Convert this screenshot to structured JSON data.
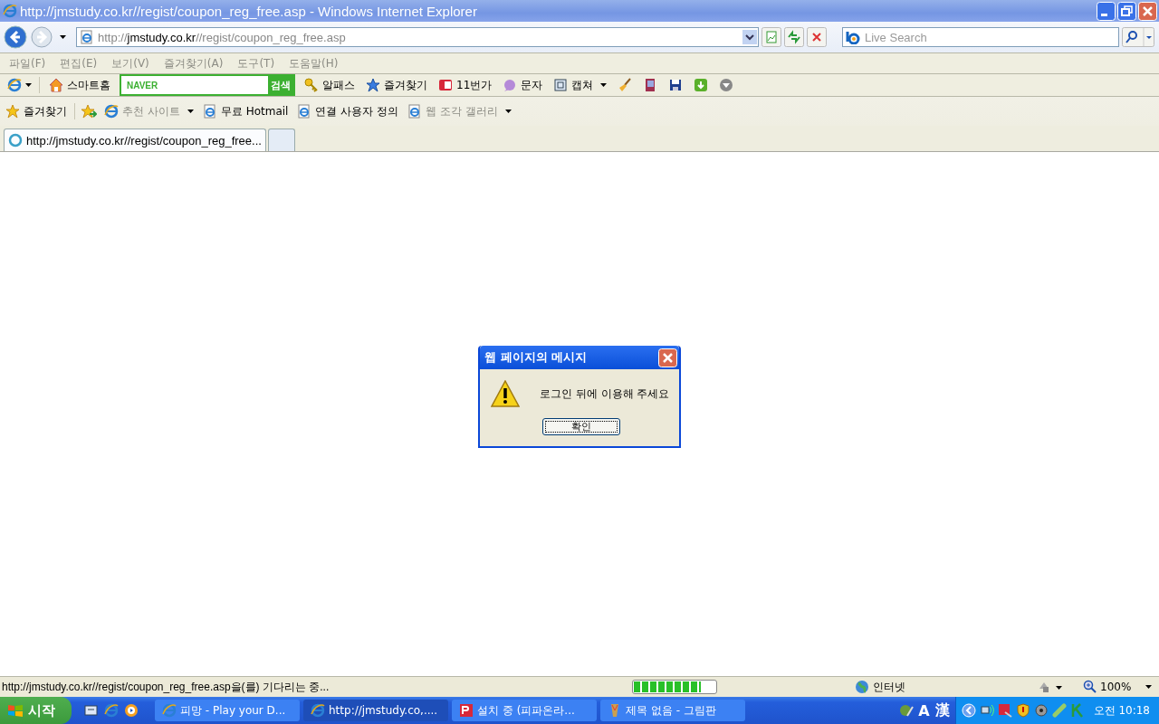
{
  "window": {
    "title": "http://jmstudy.co.kr//regist/coupon_reg_free.asp - Windows Internet Explorer"
  },
  "address": {
    "scheme": "http://",
    "host": "jmstudy.co.kr",
    "path": "//regist/coupon_reg_free.asp"
  },
  "search": {
    "placeholder": "Live Search"
  },
  "menu": [
    "파일(F)",
    "편집(E)",
    "보기(V)",
    "즐겨찾기(A)",
    "도구(T)",
    "도움말(H)"
  ],
  "toolbar": {
    "home": "스마트홈",
    "naver_logo": "NAVER",
    "naver_button": "검색",
    "items": [
      {
        "label": "알패스",
        "dropdown": false
      },
      {
        "label": "즐겨찾기",
        "dropdown": false
      },
      {
        "label": "11번가",
        "dropdown": false
      },
      {
        "label": "문자",
        "dropdown": false
      },
      {
        "label": "캡쳐",
        "dropdown": true
      }
    ]
  },
  "favorites_bar": {
    "label": "즐겨찾기",
    "items": [
      {
        "label": "추천 사이트",
        "disabled": true,
        "dropdown": true
      },
      {
        "label": "무료 Hotmail",
        "disabled": false,
        "dropdown": false
      },
      {
        "label": "연결 사용자 정의",
        "disabled": false,
        "dropdown": false
      },
      {
        "label": "웹 조각 갤러리",
        "disabled": true,
        "dropdown": true
      }
    ]
  },
  "tabs": [
    {
      "label": "http://jmstudy.co.kr//regist/coupon_reg_free...",
      "selected": true
    }
  ],
  "dialog": {
    "title": "웹 페이지의 메시지",
    "message": "로그인 뒤에 이용해 주세요",
    "button": "확인"
  },
  "status_bar": {
    "text": "http://jmstudy.co.kr//regist/coupon_reg_free.asp을(를) 기다리는 중...",
    "progress": {
      "level": 0.82
    },
    "zone": "인터넷",
    "zoom": "100%"
  },
  "taskbar": {
    "start": "시작",
    "tasks": [
      {
        "label": "피망 - Play your D...",
        "selected": false
      },
      {
        "label": "http://jmstudy.co,....",
        "selected": true
      },
      {
        "label": "설치 중 (피파온라...",
        "selected": false
      },
      {
        "label": "제목 없음 - 그림판",
        "selected": false
      }
    ],
    "ime": [
      "A",
      "漢"
    ],
    "clock": "오전 10:18"
  }
}
